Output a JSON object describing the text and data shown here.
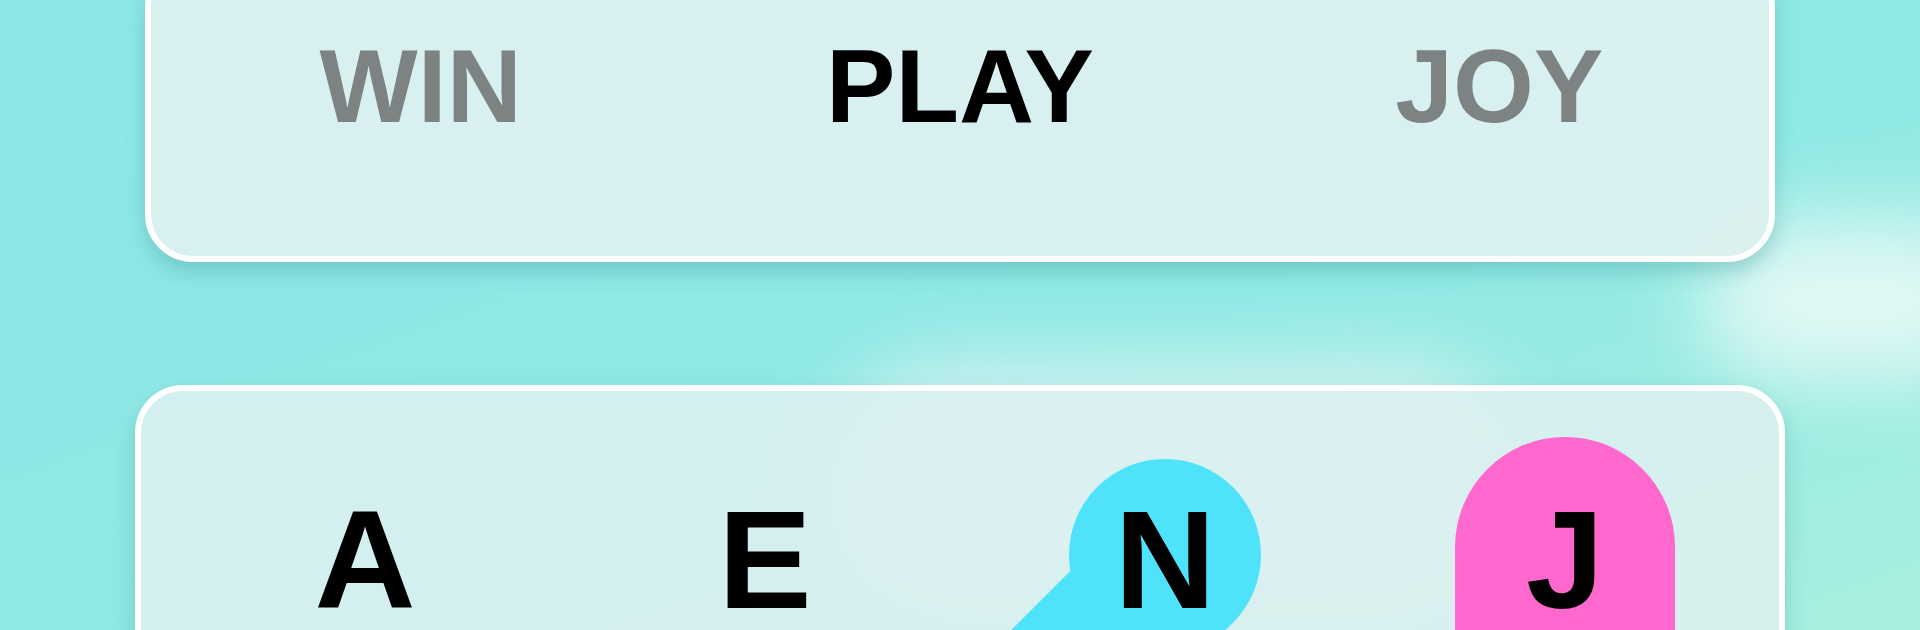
{
  "words": [
    {
      "text": "WIN",
      "selected": false
    },
    {
      "text": "PLAY",
      "selected": true
    },
    {
      "text": "JOY",
      "selected": false
    }
  ],
  "letters": [
    {
      "letter": "A"
    },
    {
      "letter": "E"
    },
    {
      "letter": "N",
      "color": "#4fe3fb"
    },
    {
      "letter": "J",
      "color": "#ff68cc"
    }
  ]
}
